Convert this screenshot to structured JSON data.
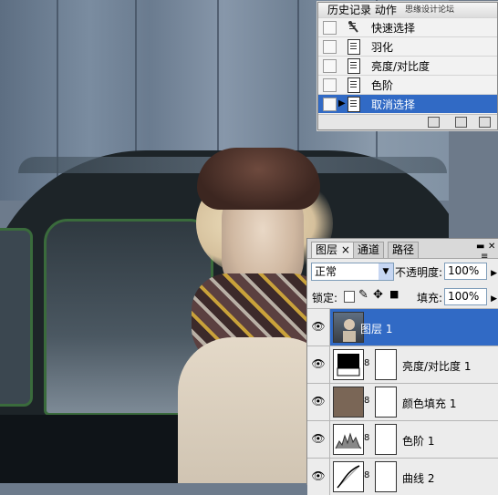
{
  "watermark": "思缘设计论坛 WWW.MISSYUAN.COM",
  "history_panel": {
    "title": "历史记录 动作",
    "items": [
      {
        "label": "快速选择",
        "selected": false
      },
      {
        "label": "羽化",
        "selected": false
      },
      {
        "label": "亮度/对比度",
        "selected": false
      },
      {
        "label": "色阶",
        "selected": false
      },
      {
        "label": "取消选择",
        "selected": true
      }
    ]
  },
  "layers_panel": {
    "tabs": [
      "图层",
      "通道",
      "路径"
    ],
    "blend_mode": "正常",
    "opacity_label": "不透明度:",
    "opacity_value": "100%",
    "lock_label": "锁定:",
    "fill_label": "填充:",
    "fill_value": "100%",
    "layers": [
      {
        "name": "图层 1",
        "selected": true,
        "thumb": "photo"
      },
      {
        "name": "亮度/对比度 1",
        "selected": false,
        "thumb": "adjust-brightness"
      },
      {
        "name": "颜色填充 1",
        "selected": false,
        "thumb": "solid-fill",
        "fill_color": "#7a6656"
      },
      {
        "name": "色阶 1",
        "selected": false,
        "thumb": "levels"
      },
      {
        "name": "曲线 2",
        "selected": false,
        "thumb": "curves"
      }
    ]
  },
  "colors": {
    "selection": "#316ac5",
    "panel_bg": "#ececec"
  }
}
